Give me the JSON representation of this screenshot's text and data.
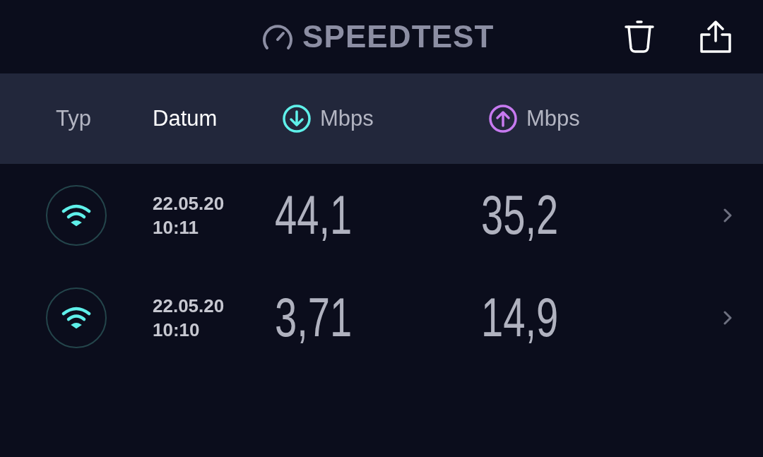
{
  "title": "SPEEDTEST",
  "columns": [
    {
      "kind": "text",
      "label": "Typ",
      "selected": false
    },
    {
      "kind": "text",
      "label": "Datum",
      "selected": true
    },
    {
      "kind": "download",
      "label": "Mbps",
      "selected": false
    },
    {
      "kind": "upload",
      "label": "Mbps",
      "selected": false
    }
  ],
  "rows": [
    {
      "kind": "wifi",
      "date": "22.05.20",
      "time": "10:11",
      "download": "44,1",
      "upload": "35,2"
    },
    {
      "kind": "wifi",
      "date": "22.05.20",
      "time": "10:10",
      "download": "3,71",
      "upload": "14,9"
    }
  ]
}
